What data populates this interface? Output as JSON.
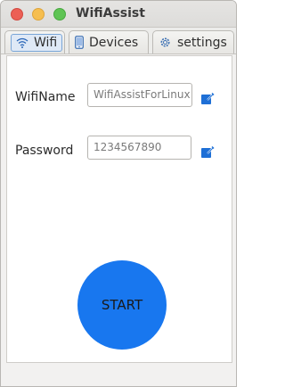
{
  "window": {
    "title": "WifiAssist"
  },
  "tabs": [
    {
      "label": "Wifi",
      "icon": "wifi-icon",
      "selected": true
    },
    {
      "label": "Devices",
      "icon": "phone-icon",
      "selected": false
    },
    {
      "label": "settings",
      "icon": "gear-icon",
      "selected": false
    }
  ],
  "form": {
    "wifi_name_label": "WifiName",
    "wifi_name_value": "WifiAssistForLinux",
    "password_label": "Password",
    "password_value": "1234567890"
  },
  "start_button": {
    "label": "START"
  },
  "colors": {
    "start_button": "#1877ef",
    "edit_icon": "#1e6fd6",
    "selected_tab_border": "#7aa6d8"
  }
}
